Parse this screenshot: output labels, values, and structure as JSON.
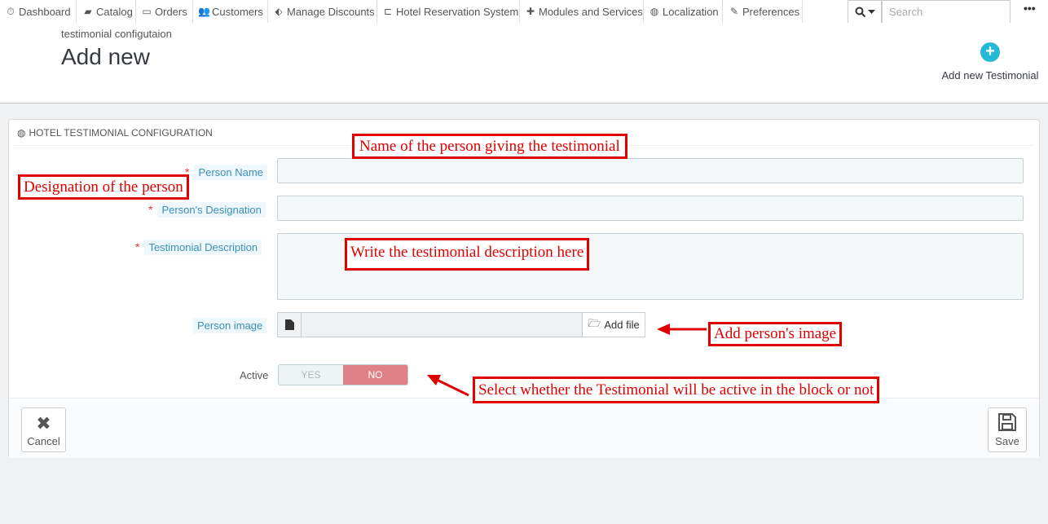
{
  "nav": {
    "items": [
      {
        "label": "Dashboard",
        "icon": "dashboard-icon",
        "glyph": "⏱"
      },
      {
        "label": "Catalog",
        "icon": "book-icon",
        "glyph": "▰"
      },
      {
        "label": "Orders",
        "icon": "credit-card-icon",
        "glyph": "▭"
      },
      {
        "label": "Customers",
        "icon": "users-icon",
        "glyph": "👥"
      },
      {
        "label": "Manage Discounts",
        "icon": "tags-icon",
        "glyph": "⬖"
      },
      {
        "label": "Hotel Reservation System",
        "icon": "bed-icon",
        "glyph": "⊏"
      },
      {
        "label": "Modules and Services",
        "icon": "puzzle-icon",
        "glyph": "✚"
      },
      {
        "label": "Localization",
        "icon": "globe-icon",
        "glyph": "◍"
      },
      {
        "label": "Preferences",
        "icon": "wrench-icon",
        "glyph": "✎"
      }
    ],
    "search_placeholder": "Search",
    "search_icon": "search-icon",
    "more_label": "•••"
  },
  "header": {
    "breadcrumb": "testimonial configutaion",
    "title": "Add new",
    "add_button_label": "Add new Testimonial",
    "add_button_icon": "plus-circle-icon"
  },
  "panel": {
    "heading": "HOTEL TESTIMONIAL CONFIGURATION",
    "heading_icon": "globe-icon",
    "fields": {
      "person_name_label": "Person Name",
      "designation_label": "Person's Designation",
      "description_label": "Testimonial Description",
      "image_label": "Person image",
      "add_file_label": "Add file",
      "active_label": "Active",
      "yes_label": "YES",
      "no_label": "NO",
      "required_mark": "*"
    },
    "footer": {
      "cancel_label": "Cancel",
      "save_label": "Save"
    }
  },
  "annotations": {
    "name": "Name of the person giving the testimonial",
    "designation": "Designation of the person",
    "description": "Write the testimonial description here",
    "image": "Add person's image",
    "active": "Select whether the Testimonial will be active in the block or not"
  },
  "colors": {
    "accent": "#25b9d7",
    "annotation_red": "#e00000",
    "switch_no": "#e08087"
  }
}
